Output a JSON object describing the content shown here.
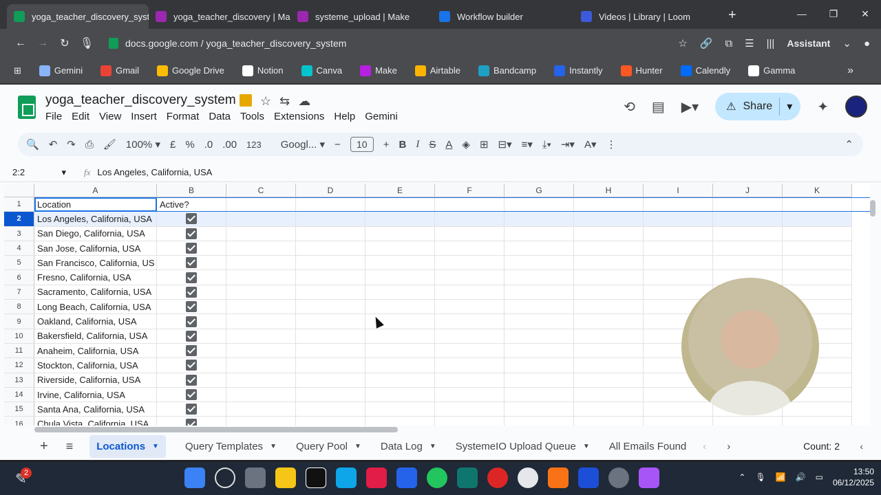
{
  "browser": {
    "tabs": [
      {
        "label": "yoga_teacher_discovery_syste",
        "color": "#0f9d58",
        "active": true
      },
      {
        "label": "yoga_teacher_discovery | Mak",
        "color": "#9c27b0",
        "active": false
      },
      {
        "label": "systeme_upload | Make",
        "color": "#9c27b0",
        "active": false
      },
      {
        "label": "Workflow builder",
        "color": "#1a73e8",
        "active": false
      },
      {
        "label": "Videos | Library | Loom",
        "color": "#3b5bdb",
        "active": false
      }
    ],
    "url": "docs.google.com / yoga_teacher_discovery_system",
    "assistant_label": "Assistant",
    "bookmarks": [
      {
        "label": "Gemini",
        "color": "#8ab4f8"
      },
      {
        "label": "Gmail",
        "color": "#ea4335"
      },
      {
        "label": "Google Drive",
        "color": "#fbbc04"
      },
      {
        "label": "Notion",
        "color": "#ffffff"
      },
      {
        "label": "Canva",
        "color": "#00c4cc"
      },
      {
        "label": "Make",
        "color": "#b620e0"
      },
      {
        "label": "Airtable",
        "color": "#fcb400"
      },
      {
        "label": "Bandcamp",
        "color": "#1da0c3"
      },
      {
        "label": "Instantly",
        "color": "#2563eb"
      },
      {
        "label": "Hunter",
        "color": "#ff5722"
      },
      {
        "label": "Calendly",
        "color": "#006bff"
      },
      {
        "label": "Gamma",
        "color": "#ffffff"
      }
    ]
  },
  "doc": {
    "title": "yoga_teacher_discovery_system",
    "menus": [
      "File",
      "Edit",
      "View",
      "Insert",
      "Format",
      "Data",
      "Tools",
      "Extensions",
      "Help",
      "Gemini"
    ],
    "share_label": "Share"
  },
  "toolbar": {
    "zoom": "100%",
    "currency": "£",
    "percent": "%",
    "dec_decrease": ".0",
    "dec_increase": ".00",
    "format_123": "123",
    "font": "Googl...",
    "font_size": "10"
  },
  "formula_bar": {
    "cell_ref": "2:2",
    "content": "Los Angeles, California, USA"
  },
  "grid": {
    "columns": [
      "A",
      "B",
      "C",
      "D",
      "E",
      "F",
      "G",
      "H",
      "I",
      "J",
      "K"
    ],
    "header_row": {
      "a": "Location",
      "b": "Active?"
    },
    "rows": [
      {
        "n": "2",
        "location": "Los Angeles, California, USA",
        "active": true
      },
      {
        "n": "3",
        "location": "San Diego, California, USA",
        "active": true
      },
      {
        "n": "4",
        "location": "San Jose, California, USA",
        "active": true
      },
      {
        "n": "5",
        "location": "San Francisco, California, US",
        "active": true
      },
      {
        "n": "6",
        "location": "Fresno, California, USA",
        "active": true
      },
      {
        "n": "7",
        "location": "Sacramento, California, USA",
        "active": true
      },
      {
        "n": "8",
        "location": "Long Beach, California, USA",
        "active": true
      },
      {
        "n": "9",
        "location": "Oakland, California, USA",
        "active": true
      },
      {
        "n": "10",
        "location": "Bakersfield, California, USA",
        "active": true
      },
      {
        "n": "11",
        "location": "Anaheim, California, USA",
        "active": true
      },
      {
        "n": "12",
        "location": "Stockton, California, USA",
        "active": true
      },
      {
        "n": "13",
        "location": "Riverside, California, USA",
        "active": true
      },
      {
        "n": "14",
        "location": "Irvine, California, USA",
        "active": true
      },
      {
        "n": "15",
        "location": "Santa Ana, California, USA",
        "active": true
      },
      {
        "n": "16",
        "location": "Chula Vista, California, USA",
        "active": true
      }
    ]
  },
  "sheet_tabs": [
    {
      "label": "Locations",
      "active": true
    },
    {
      "label": "Query Templates",
      "active": false
    },
    {
      "label": "Query Pool",
      "active": false
    },
    {
      "label": "Data Log",
      "active": false
    },
    {
      "label": "SystemeIO Upload Queue",
      "active": false
    },
    {
      "label": "All Emails Found",
      "active": false
    }
  ],
  "status": {
    "count": "Count: 2"
  },
  "taskbar": {
    "notification_count": "2",
    "time": "13:50",
    "date": "06/12/2025"
  }
}
